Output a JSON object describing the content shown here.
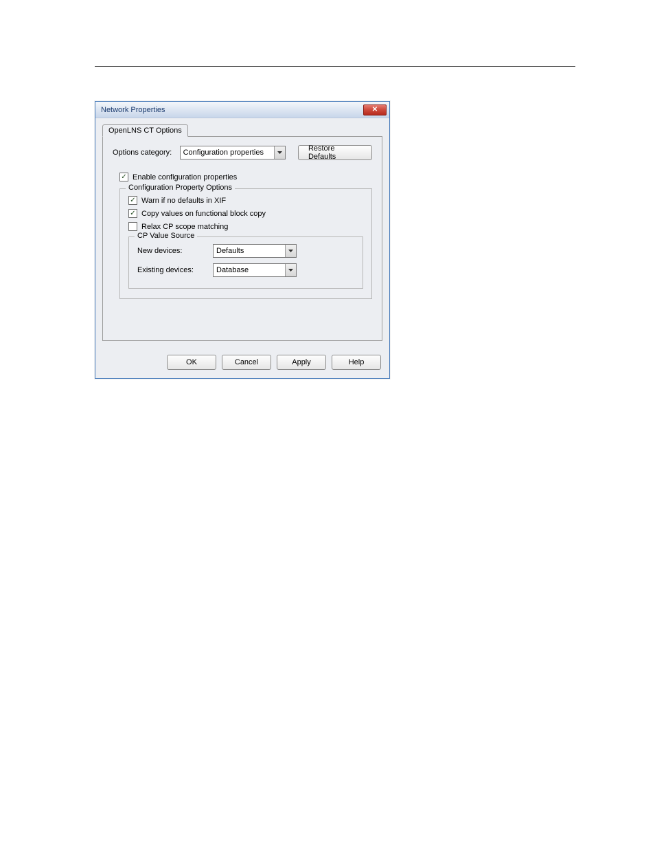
{
  "dialog": {
    "title": "Network Properties",
    "tab_label": "OpenLNS CT Options",
    "options_category_label": "Options category:",
    "options_category_value": "Configuration properties",
    "restore_defaults_label": "Restore Defaults",
    "enable_cp_label": "Enable configuration properties",
    "enable_cp_checked": true,
    "cpo_legend": "Configuration Property Options",
    "warn_label": "Warn if no defaults in XIF",
    "warn_checked": true,
    "copy_label": "Copy values on functional block copy",
    "copy_checked": true,
    "relax_label": "Relax CP scope matching",
    "relax_checked": false,
    "cpvs_legend": "CP Value Source",
    "new_devices_label": "New devices:",
    "new_devices_value": "Defaults",
    "existing_devices_label": "Existing devices:",
    "existing_devices_value": "Database",
    "ok_label": "OK",
    "cancel_label": "Cancel",
    "apply_label": "Apply",
    "help_label": "Help"
  }
}
